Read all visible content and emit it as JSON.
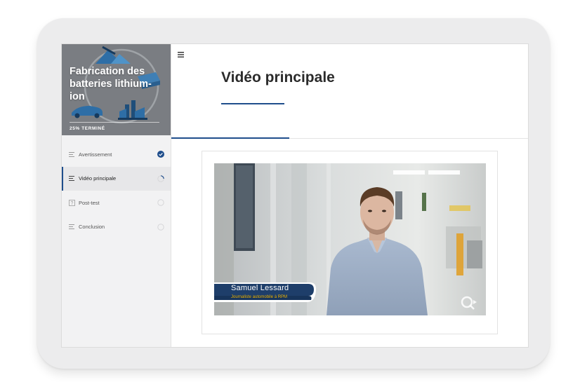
{
  "course": {
    "title": "Fabrication des batteries lithium-ion",
    "progress_label": "25% TERMINÉ",
    "progress_percent": 25
  },
  "menu": {
    "items": [
      {
        "label": "Avertissement",
        "icon": "lines-icon",
        "status": "complete"
      },
      {
        "label": "Vidéo principale",
        "icon": "lines-icon",
        "status": "in-progress"
      },
      {
        "label": "Post-test",
        "icon": "question-box-icon",
        "status": "not-started"
      },
      {
        "label": "Conclusion",
        "icon": "lines-icon",
        "status": "not-started"
      }
    ],
    "active_index": 1
  },
  "main": {
    "title": "Vidéo principale",
    "video": {
      "presenter_name": "Samuel Lessard",
      "presenter_role": "Journaliste automobile à RPM",
      "watermark": "Q-icon"
    }
  },
  "colors": {
    "accent": "#1f4e8c",
    "sidebar_bg": "#f2f2f3",
    "header_image_bg": "#7a7d82",
    "lower_third_bg": "#1e3e6a",
    "role_text": "#f0b400"
  }
}
